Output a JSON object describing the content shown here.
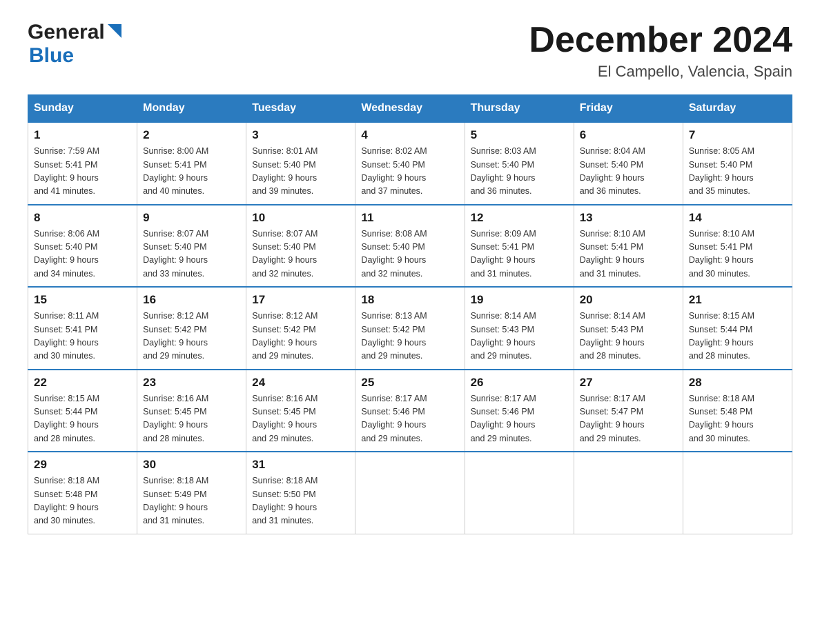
{
  "header": {
    "logo_general": "General",
    "logo_blue": "Blue",
    "month": "December 2024",
    "location": "El Campello, Valencia, Spain"
  },
  "days_of_week": [
    "Sunday",
    "Monday",
    "Tuesday",
    "Wednesday",
    "Thursday",
    "Friday",
    "Saturday"
  ],
  "weeks": [
    [
      {
        "day": "1",
        "info": "Sunrise: 7:59 AM\nSunset: 5:41 PM\nDaylight: 9 hours\nand 41 minutes."
      },
      {
        "day": "2",
        "info": "Sunrise: 8:00 AM\nSunset: 5:41 PM\nDaylight: 9 hours\nand 40 minutes."
      },
      {
        "day": "3",
        "info": "Sunrise: 8:01 AM\nSunset: 5:40 PM\nDaylight: 9 hours\nand 39 minutes."
      },
      {
        "day": "4",
        "info": "Sunrise: 8:02 AM\nSunset: 5:40 PM\nDaylight: 9 hours\nand 37 minutes."
      },
      {
        "day": "5",
        "info": "Sunrise: 8:03 AM\nSunset: 5:40 PM\nDaylight: 9 hours\nand 36 minutes."
      },
      {
        "day": "6",
        "info": "Sunrise: 8:04 AM\nSunset: 5:40 PM\nDaylight: 9 hours\nand 36 minutes."
      },
      {
        "day": "7",
        "info": "Sunrise: 8:05 AM\nSunset: 5:40 PM\nDaylight: 9 hours\nand 35 minutes."
      }
    ],
    [
      {
        "day": "8",
        "info": "Sunrise: 8:06 AM\nSunset: 5:40 PM\nDaylight: 9 hours\nand 34 minutes."
      },
      {
        "day": "9",
        "info": "Sunrise: 8:07 AM\nSunset: 5:40 PM\nDaylight: 9 hours\nand 33 minutes."
      },
      {
        "day": "10",
        "info": "Sunrise: 8:07 AM\nSunset: 5:40 PM\nDaylight: 9 hours\nand 32 minutes."
      },
      {
        "day": "11",
        "info": "Sunrise: 8:08 AM\nSunset: 5:40 PM\nDaylight: 9 hours\nand 32 minutes."
      },
      {
        "day": "12",
        "info": "Sunrise: 8:09 AM\nSunset: 5:41 PM\nDaylight: 9 hours\nand 31 minutes."
      },
      {
        "day": "13",
        "info": "Sunrise: 8:10 AM\nSunset: 5:41 PM\nDaylight: 9 hours\nand 31 minutes."
      },
      {
        "day": "14",
        "info": "Sunrise: 8:10 AM\nSunset: 5:41 PM\nDaylight: 9 hours\nand 30 minutes."
      }
    ],
    [
      {
        "day": "15",
        "info": "Sunrise: 8:11 AM\nSunset: 5:41 PM\nDaylight: 9 hours\nand 30 minutes."
      },
      {
        "day": "16",
        "info": "Sunrise: 8:12 AM\nSunset: 5:42 PM\nDaylight: 9 hours\nand 29 minutes."
      },
      {
        "day": "17",
        "info": "Sunrise: 8:12 AM\nSunset: 5:42 PM\nDaylight: 9 hours\nand 29 minutes."
      },
      {
        "day": "18",
        "info": "Sunrise: 8:13 AM\nSunset: 5:42 PM\nDaylight: 9 hours\nand 29 minutes."
      },
      {
        "day": "19",
        "info": "Sunrise: 8:14 AM\nSunset: 5:43 PM\nDaylight: 9 hours\nand 29 minutes."
      },
      {
        "day": "20",
        "info": "Sunrise: 8:14 AM\nSunset: 5:43 PM\nDaylight: 9 hours\nand 28 minutes."
      },
      {
        "day": "21",
        "info": "Sunrise: 8:15 AM\nSunset: 5:44 PM\nDaylight: 9 hours\nand 28 minutes."
      }
    ],
    [
      {
        "day": "22",
        "info": "Sunrise: 8:15 AM\nSunset: 5:44 PM\nDaylight: 9 hours\nand 28 minutes."
      },
      {
        "day": "23",
        "info": "Sunrise: 8:16 AM\nSunset: 5:45 PM\nDaylight: 9 hours\nand 28 minutes."
      },
      {
        "day": "24",
        "info": "Sunrise: 8:16 AM\nSunset: 5:45 PM\nDaylight: 9 hours\nand 29 minutes."
      },
      {
        "day": "25",
        "info": "Sunrise: 8:17 AM\nSunset: 5:46 PM\nDaylight: 9 hours\nand 29 minutes."
      },
      {
        "day": "26",
        "info": "Sunrise: 8:17 AM\nSunset: 5:46 PM\nDaylight: 9 hours\nand 29 minutes."
      },
      {
        "day": "27",
        "info": "Sunrise: 8:17 AM\nSunset: 5:47 PM\nDaylight: 9 hours\nand 29 minutes."
      },
      {
        "day": "28",
        "info": "Sunrise: 8:18 AM\nSunset: 5:48 PM\nDaylight: 9 hours\nand 30 minutes."
      }
    ],
    [
      {
        "day": "29",
        "info": "Sunrise: 8:18 AM\nSunset: 5:48 PM\nDaylight: 9 hours\nand 30 minutes."
      },
      {
        "day": "30",
        "info": "Sunrise: 8:18 AM\nSunset: 5:49 PM\nDaylight: 9 hours\nand 31 minutes."
      },
      {
        "day": "31",
        "info": "Sunrise: 8:18 AM\nSunset: 5:50 PM\nDaylight: 9 hours\nand 31 minutes."
      },
      {
        "day": "",
        "info": ""
      },
      {
        "day": "",
        "info": ""
      },
      {
        "day": "",
        "info": ""
      },
      {
        "day": "",
        "info": ""
      }
    ]
  ]
}
